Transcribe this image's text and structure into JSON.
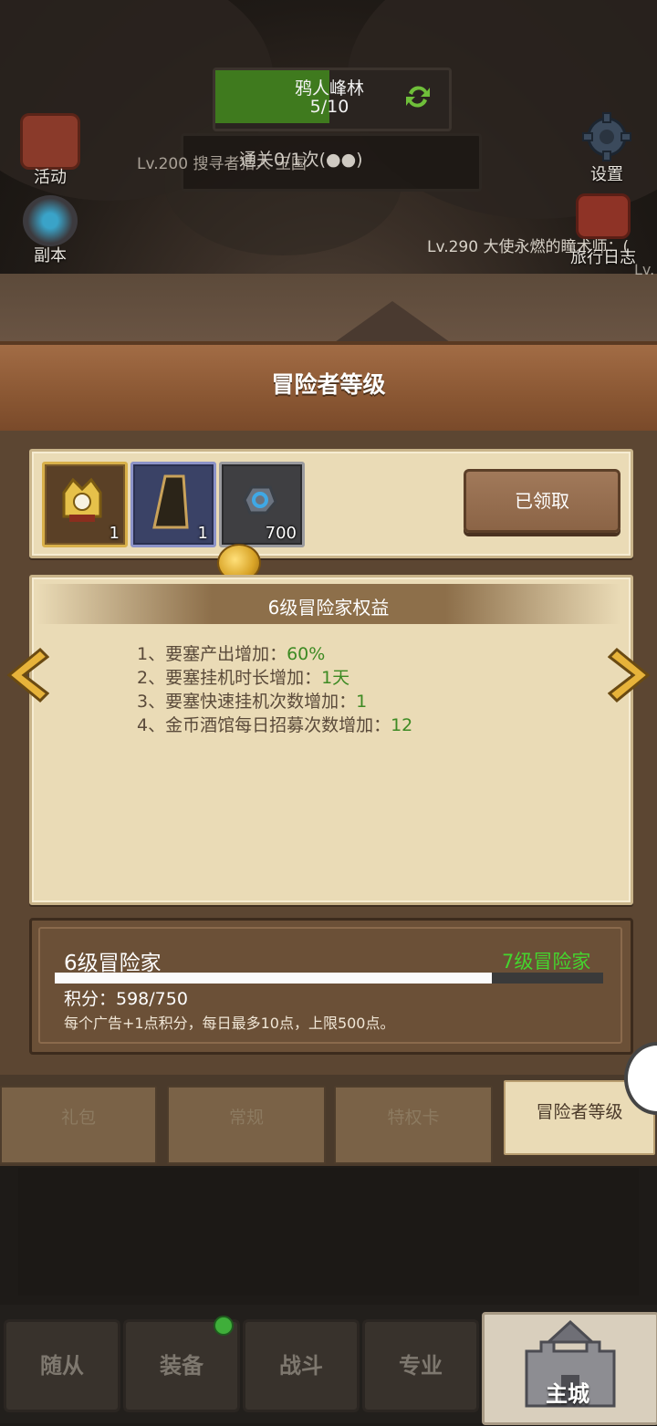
{
  "top_hud": {
    "stage_name": "鸦人峰林",
    "stage_progress": "5/10",
    "status_text": "通关0/1次(●●)",
    "marquee_left": "Lv.200 搜寻者猎人 王国",
    "marquee_right": "Lv.290 大使永燃的瞳术师：(",
    "marquee_right2": "Lv."
  },
  "side_buttons": {
    "events": "活动",
    "dungeon": "副本",
    "settings": "设置",
    "travel_log": "旅行日志"
  },
  "panel": {
    "title": "冒险者等级",
    "rewards": [
      {
        "icon": "golden-helmet-icon",
        "count": "1"
      },
      {
        "icon": "cloak-icon",
        "count": "1"
      },
      {
        "icon": "blue-gem-stone-icon",
        "count": "700"
      }
    ],
    "claim_button": "已领取",
    "benefits_title": "6级冒险家权益",
    "benefits": [
      {
        "prefix": "1、要塞产出增加：",
        "value": "60%"
      },
      {
        "prefix": "2、要塞挂机时长增加：",
        "value": "1天"
      },
      {
        "prefix": "3、要塞快速挂机次数增加：",
        "value": "1"
      },
      {
        "prefix": "4、金币酒馆每日招募次数增加：",
        "value": "12"
      }
    ],
    "current_level": "6级冒险家",
    "next_level": "7级冒险家",
    "points_label": "积分：598/750",
    "points_current": 598,
    "points_max": 750,
    "ad_note": "每个广告+1点积分，每日最多10点，上限500点。"
  },
  "tabs": [
    "礼包",
    "常规",
    "特权卡",
    "冒险者等级"
  ],
  "active_tab": "冒险者等级",
  "bottom_nav": [
    "随从",
    "装备",
    "战斗",
    "专业",
    "主城"
  ],
  "colors": {
    "accent_green": "#3d8a23",
    "next_level_green": "#44d62e",
    "parchment": "#eadbb6",
    "header_brown": "#8a5733"
  }
}
